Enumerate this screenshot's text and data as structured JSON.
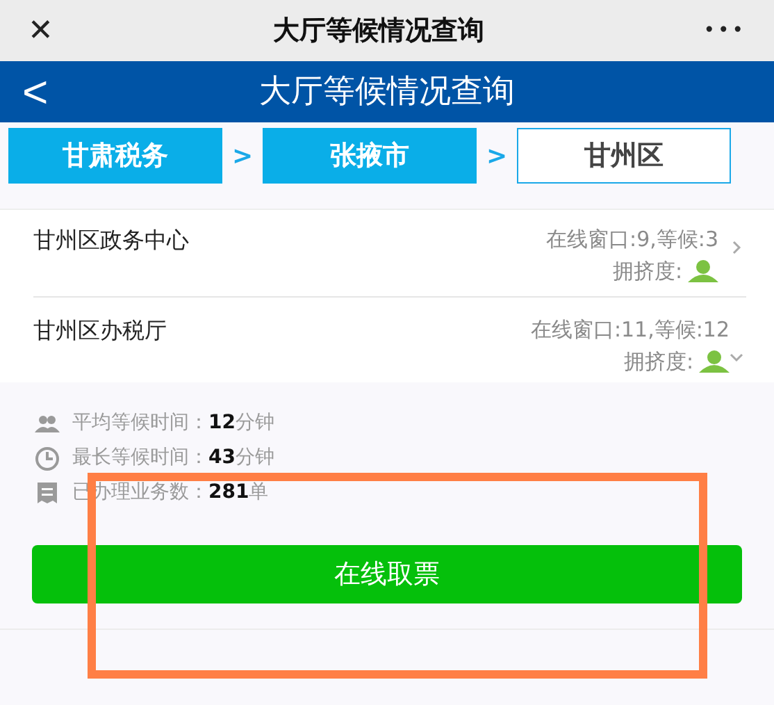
{
  "top_bar": {
    "close": "✕",
    "title": "大厅等候情况查询",
    "more": "•••"
  },
  "header": {
    "back": "<",
    "title": "大厅等候情况查询"
  },
  "breadcrumb": [
    {
      "label": "甘肃税务",
      "selected": false
    },
    {
      "label": "张掖市",
      "selected": false
    },
    {
      "label": "甘州区",
      "selected": true
    }
  ],
  "separator": ">",
  "halls": [
    {
      "name": "甘州区政务中心",
      "status": "在线窗口:9,等候:3",
      "crowd_label": "拥挤度:",
      "expanded": false
    },
    {
      "name": "甘州区办税厅",
      "status": "在线窗口:11,等候:12",
      "crowd_label": "拥挤度:",
      "expanded": true
    }
  ],
  "stats": [
    {
      "kind": "people",
      "label": "平均等候时间：",
      "value": "12",
      "unit": "分钟"
    },
    {
      "kind": "clock",
      "label": "最长等候时间：",
      "value": "43",
      "unit": "分钟"
    },
    {
      "kind": "receipt",
      "label": "已办理业务数：",
      "value": "281",
      "unit": "单"
    }
  ],
  "action_button": "在线取票"
}
